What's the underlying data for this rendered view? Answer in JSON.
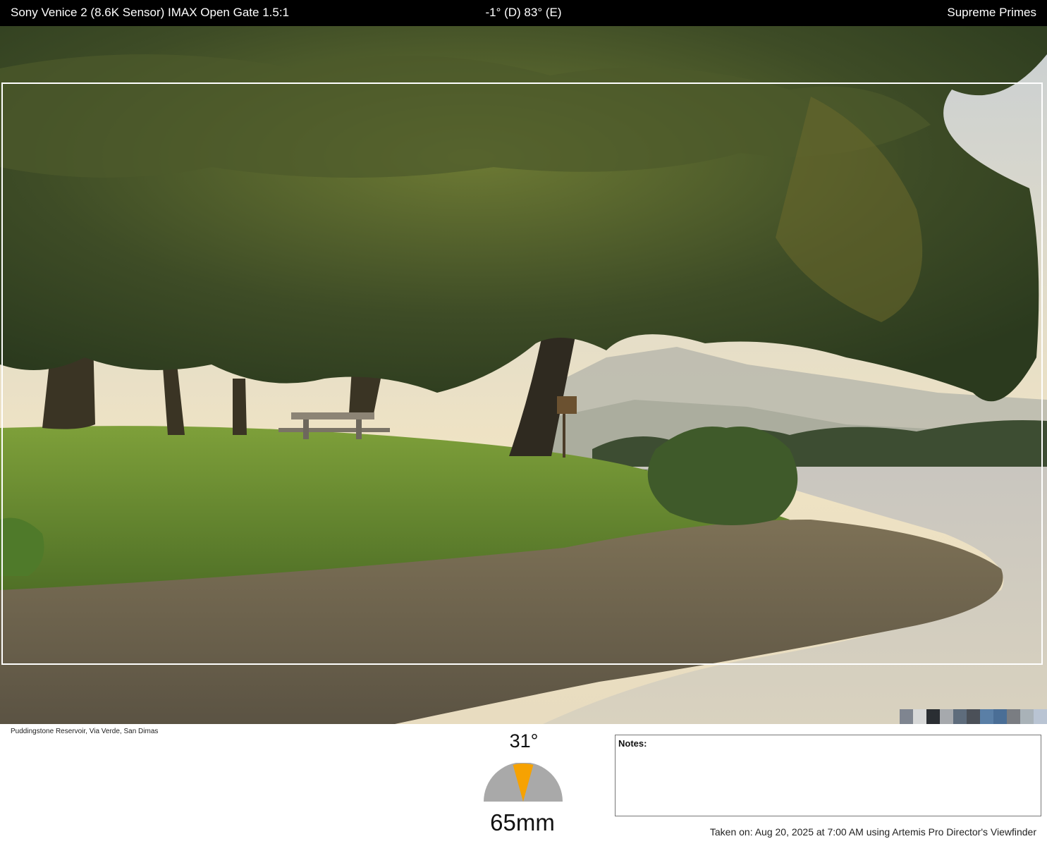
{
  "header": {
    "camera_format": "Sony Venice 2 (8.6K Sensor) IMAX Open Gate 1.5:1",
    "orientation": "-1° (D) 83° (E)",
    "lens_set": "Supreme Primes"
  },
  "photo": {
    "description_icon": "landscape-photo",
    "swatch_colors": [
      "#7f8590",
      "#d7d8d8",
      "#2a2e33",
      "#a6a9ad",
      "#5e6c7c",
      "#4b5058",
      "#5a7fa6",
      "#4a6e96",
      "#7a7d82",
      "#a9b2b8",
      "#b9c4d3"
    ]
  },
  "footer": {
    "location": "Puddingstone Reservoir, Via Verde, San Dimas",
    "field_of_view": "31°",
    "fov_fraction": 0.172,
    "focal_length": "65mm",
    "notes_label": "Notes:",
    "taken_on": "Taken on: Aug 20, 2025 at 7:00 AM using Artemis Pro Director's Viewfinder"
  }
}
